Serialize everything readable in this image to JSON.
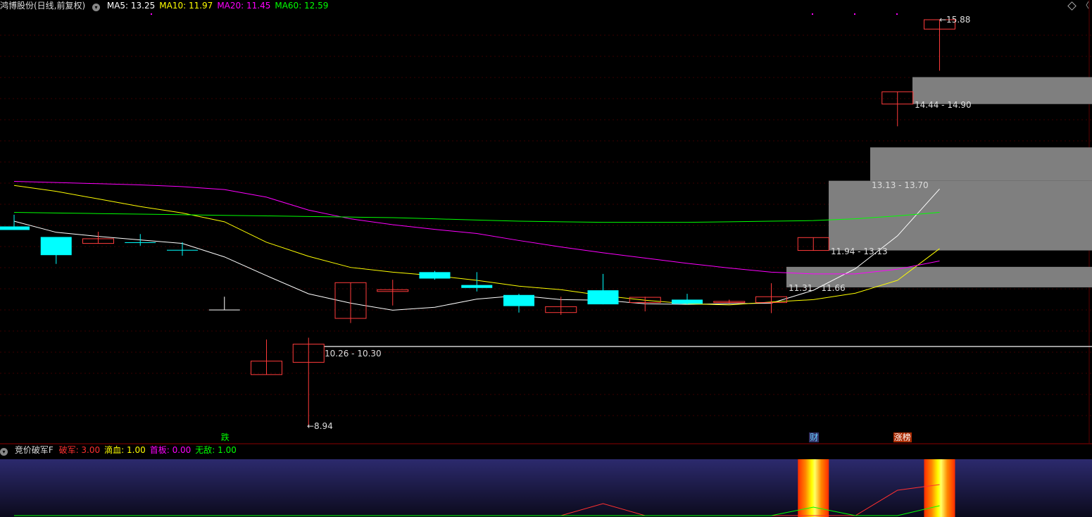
{
  "header": {
    "stock_name": "鸿博股份(日线,前复权)",
    "ma": [
      {
        "label": "MA5: 13.25",
        "color": "#ffffff"
      },
      {
        "label": "MA10: 11.97",
        "color": "#ffff00"
      },
      {
        "label": "MA20: 11.45",
        "color": "#ff00ff"
      },
      {
        "label": "MA60: 12.59",
        "color": "#00ff00"
      }
    ]
  },
  "indicator": {
    "name": "竞价破军F",
    "values": [
      {
        "label": "破军: 3.00",
        "color": "#ff3030"
      },
      {
        "label": "滴血: 1.00",
        "color": "#ffff00"
      },
      {
        "label": "首板: 0.00",
        "color": "#ff00ff"
      },
      {
        "label": "无敌: 1.00",
        "color": "#00ff00"
      }
    ]
  },
  "price_axis": {
    "top_price": 15.88,
    "bottom_price": 8.94
  },
  "chart_data": {
    "type": "candlestick",
    "candles": [
      {
        "open": 12.35,
        "close": 12.29,
        "high": 12.55,
        "low": 12.29,
        "color": "cyan"
      },
      {
        "open": 12.17,
        "close": 11.86,
        "high": 12.17,
        "low": 11.71,
        "color": "cyan"
      },
      {
        "open": 12.06,
        "close": 12.14,
        "high": 12.26,
        "low": 12.06,
        "color": "red"
      },
      {
        "open": 12.08,
        "close": 12.07,
        "high": 12.22,
        "low": 12.02,
        "color": "cyan"
      },
      {
        "open": 11.95,
        "close": 11.94,
        "high": 12.08,
        "low": 11.85,
        "color": "cyan"
      },
      {
        "open": 10.93,
        "close": 10.93,
        "high": 11.15,
        "low": 10.93,
        "color": "white"
      },
      {
        "open": 9.82,
        "close": 10.05,
        "high": 10.42,
        "low": 9.82,
        "color": "red"
      },
      {
        "open": 10.03,
        "close": 10.34,
        "high": 10.45,
        "low": 8.94,
        "color": "red"
      },
      {
        "open": 10.78,
        "close": 11.39,
        "high": 11.39,
        "low": 10.7,
        "color": "red"
      },
      {
        "open": 11.24,
        "close": 11.27,
        "high": 11.44,
        "low": 11.0,
        "color": "red"
      },
      {
        "open": 11.57,
        "close": 11.46,
        "high": 11.59,
        "low": 11.44,
        "color": "cyan"
      },
      {
        "open": 11.35,
        "close": 11.3,
        "high": 11.57,
        "low": 11.24,
        "color": "cyan"
      },
      {
        "open": 11.18,
        "close": 10.99,
        "high": 11.2,
        "low": 10.88,
        "color": "cyan"
      },
      {
        "open": 10.88,
        "close": 10.98,
        "high": 11.15,
        "low": 10.84,
        "color": "red"
      },
      {
        "open": 11.26,
        "close": 11.02,
        "high": 11.54,
        "low": 11.02,
        "color": "cyan"
      },
      {
        "open": 11.05,
        "close": 11.14,
        "high": 11.15,
        "low": 10.9,
        "color": "red"
      },
      {
        "open": 11.1,
        "close": 11.03,
        "high": 11.2,
        "low": 11.02,
        "color": "cyan"
      },
      {
        "open": 11.05,
        "close": 11.07,
        "high": 11.1,
        "low": 11.04,
        "color": "red"
      },
      {
        "open": 11.05,
        "close": 11.15,
        "high": 11.38,
        "low": 10.87,
        "color": "red"
      },
      {
        "open": 11.94,
        "close": 12.16,
        "high": 12.16,
        "low": 11.94,
        "color": "red"
      },
      null,
      {
        "open": 14.44,
        "close": 14.65,
        "high": 14.65,
        "low": 14.06,
        "color": "red"
      },
      {
        "open": 15.72,
        "close": 15.88,
        "high": 15.88,
        "low": 15.01,
        "color": "red"
      }
    ],
    "ma_lines": [
      {
        "name": "MA5",
        "color": "#ffffff",
        "values": [
          12.44,
          12.25,
          12.18,
          12.12,
          12.06,
          11.83,
          11.51,
          11.2,
          11.04,
          10.92,
          10.97,
          11.11,
          11.17,
          11.1,
          11.09,
          11.03,
          11.02,
          11.03,
          11.04,
          11.26,
          11.63,
          12.19,
          12.99
        ]
      },
      {
        "name": "MA10",
        "color": "#ffff00",
        "values": [
          13.05,
          12.95,
          12.82,
          12.69,
          12.58,
          12.43,
          12.08,
          11.84,
          11.65,
          11.57,
          11.51,
          11.43,
          11.33,
          11.27,
          11.17,
          11.09,
          11.03,
          11.01,
          11.06,
          11.1,
          11.21,
          11.43,
          11.97
        ]
      },
      {
        "name": "MA20",
        "color": "#ff00ff",
        "values": [
          13.12,
          13.1,
          13.08,
          13.06,
          13.03,
          12.98,
          12.85,
          12.63,
          12.48,
          12.38,
          12.3,
          12.23,
          12.11,
          12.0,
          11.9,
          11.81,
          11.72,
          11.64,
          11.57,
          11.54,
          11.54,
          11.62,
          11.76
        ]
      },
      {
        "name": "MA60",
        "color": "#00ff00",
        "values": [
          12.59,
          12.58,
          12.57,
          12.56,
          12.55,
          12.54,
          12.53,
          12.52,
          12.51,
          12.5,
          12.48,
          12.46,
          12.44,
          12.43,
          12.42,
          12.42,
          12.42,
          12.43,
          12.44,
          12.45,
          12.48,
          12.53,
          12.59
        ]
      }
    ],
    "zones": [
      {
        "label": "14.44 - 14.90",
        "low": 14.44,
        "high": 14.9
      },
      {
        "label": "13.13 - 13.70",
        "low": 13.13,
        "high": 13.7
      },
      {
        "label": "11.94 - 13.13",
        "low": 11.94,
        "high": 13.13
      },
      {
        "label": "11.31 - 11.66",
        "low": 11.31,
        "high": 11.66
      }
    ],
    "support_line": {
      "label": "10.26 - 10.30",
      "price": 10.3
    },
    "extremes": {
      "high_label": "15.88",
      "low_label": "8.94"
    },
    "signals": [
      {
        "text": "跌",
        "candle": 5,
        "color": "#00ff00",
        "bg": ""
      },
      {
        "text": "财",
        "candle": 19,
        "color": "#66ccff",
        "bg": "#333366"
      },
      {
        "text": "涨榜",
        "candle": 21,
        "color": "#ffffff",
        "bg": "#aa2a00"
      }
    ],
    "indicator_series": [
      {
        "name": "破军",
        "color": "#ff3030",
        "values": [
          0,
          0,
          0,
          0,
          0,
          0,
          0,
          0,
          0,
          0,
          0,
          0,
          0,
          0,
          0.85,
          0,
          0,
          0,
          0,
          0,
          0,
          1.8,
          2.2
        ]
      },
      {
        "name": "无敌",
        "color": "#00ff00",
        "values": [
          0,
          0,
          0,
          0,
          0,
          0,
          0,
          0,
          0,
          0,
          0,
          0,
          0,
          0,
          0,
          0,
          0,
          0,
          0,
          0.6,
          0,
          0,
          0.7
        ]
      }
    ],
    "indicator_bars": [
      19,
      22
    ]
  }
}
